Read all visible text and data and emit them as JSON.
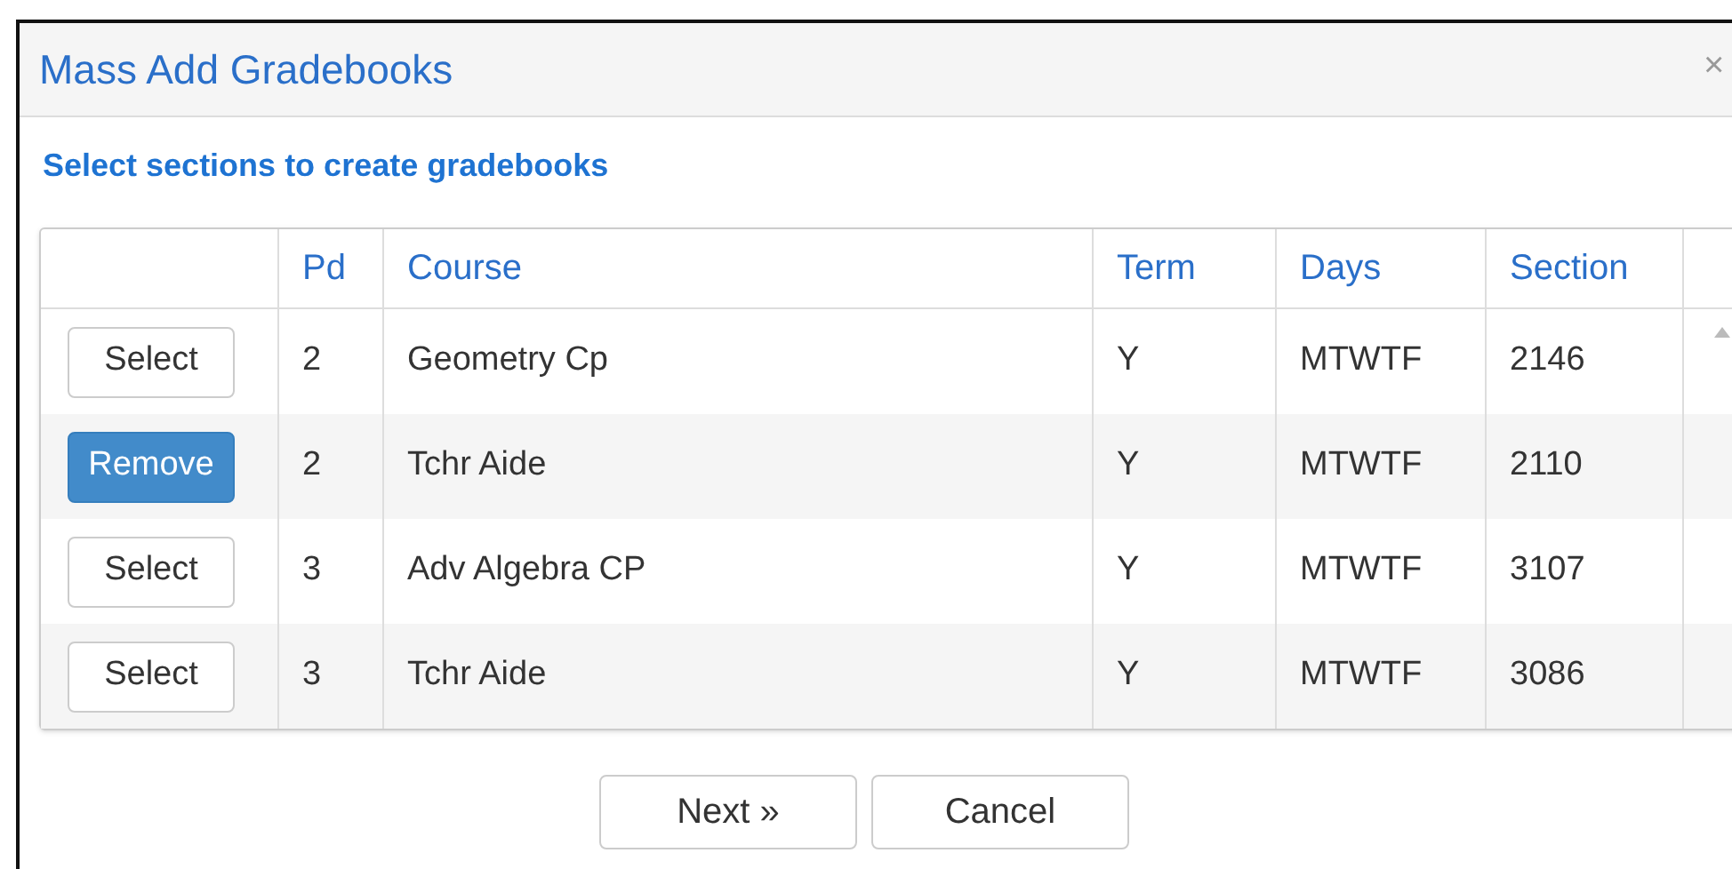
{
  "dialog": {
    "title": "Mass Add Gradebooks",
    "close": "×",
    "heading": "Select sections to create gradebooks"
  },
  "table": {
    "columns": [
      "Pd",
      "Course",
      "Term",
      "Days",
      "Section"
    ],
    "rows": [
      {
        "action": "Select",
        "selected": false,
        "cells": [
          "2",
          "Geometry Cp",
          "Y",
          "MTWTF",
          "2146"
        ]
      },
      {
        "action": "Remove",
        "selected": true,
        "cells": [
          "2",
          "Tchr Aide",
          "Y",
          "MTWTF",
          "2110"
        ]
      },
      {
        "action": "Select",
        "selected": false,
        "cells": [
          "3",
          "Adv Algebra CP",
          "Y",
          "MTWTF",
          "3107"
        ]
      },
      {
        "action": "Select",
        "selected": false,
        "cells": [
          "3",
          "Tchr Aide",
          "Y",
          "MTWTF",
          "3086"
        ]
      }
    ]
  },
  "buttons": [
    "Next »",
    "Cancel"
  ]
}
